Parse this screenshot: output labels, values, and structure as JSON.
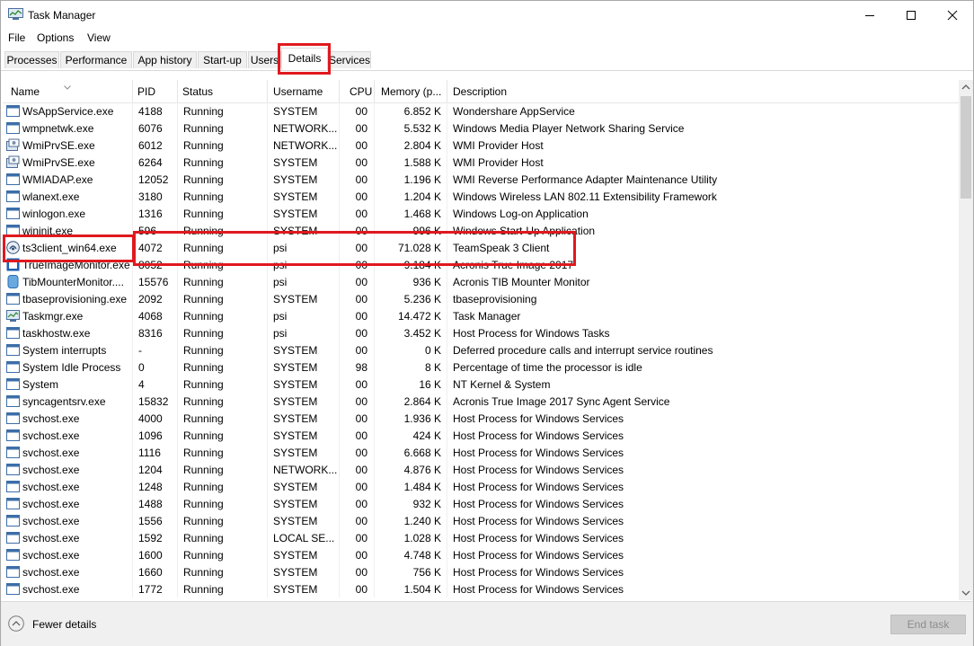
{
  "window": {
    "title": "Task Manager",
    "min_icon": "minimize-icon",
    "max_icon": "maximize-icon",
    "close_icon": "close-icon"
  },
  "menu": [
    "File",
    "Options",
    "View"
  ],
  "tabs": [
    {
      "label": "Processes"
    },
    {
      "label": "Performance"
    },
    {
      "label": "App history"
    },
    {
      "label": "Start-up"
    },
    {
      "label": "Users"
    },
    {
      "label": "Details",
      "active": true
    },
    {
      "label": "Services"
    }
  ],
  "columns": {
    "name": "Name",
    "pid": "PID",
    "status": "Status",
    "username": "Username",
    "cpu": "CPU",
    "memory": "Memory (p...",
    "description": "Description"
  },
  "rows": [
    {
      "icon": "app-icon",
      "name": "WsAppService.exe",
      "pid": "4188",
      "status": "Running",
      "user": "SYSTEM",
      "cpu": "00",
      "mem": "6.852 K",
      "desc": "Wondershare AppService"
    },
    {
      "icon": "app-icon",
      "name": "wmpnetwk.exe",
      "pid": "6076",
      "status": "Running",
      "user": "NETWORK...",
      "cpu": "00",
      "mem": "5.532 K",
      "desc": "Windows Media Player Network Sharing Service"
    },
    {
      "icon": "wmi-icon",
      "name": "WmiPrvSE.exe",
      "pid": "6012",
      "status": "Running",
      "user": "NETWORK...",
      "cpu": "00",
      "mem": "2.804 K",
      "desc": "WMI Provider Host"
    },
    {
      "icon": "wmi-icon",
      "name": "WmiPrvSE.exe",
      "pid": "6264",
      "status": "Running",
      "user": "SYSTEM",
      "cpu": "00",
      "mem": "1.588 K",
      "desc": "WMI Provider Host"
    },
    {
      "icon": "app-icon",
      "name": "WMIADAP.exe",
      "pid": "12052",
      "status": "Running",
      "user": "SYSTEM",
      "cpu": "00",
      "mem": "1.196 K",
      "desc": "WMI Reverse Performance Adapter Maintenance Utility"
    },
    {
      "icon": "app-icon",
      "name": "wlanext.exe",
      "pid": "3180",
      "status": "Running",
      "user": "SYSTEM",
      "cpu": "00",
      "mem": "1.204 K",
      "desc": "Windows Wireless LAN 802.11 Extensibility Framework"
    },
    {
      "icon": "app-icon",
      "name": "winlogon.exe",
      "pid": "1316",
      "status": "Running",
      "user": "SYSTEM",
      "cpu": "00",
      "mem": "1.468 K",
      "desc": "Windows Log-on Application"
    },
    {
      "icon": "app-icon",
      "name": "wininit.exe",
      "pid": "596",
      "status": "Running",
      "user": "SYSTEM",
      "cpu": "00",
      "mem": "996 K",
      "desc": "Windows Start-Up Application"
    },
    {
      "icon": "teamspeak-icon",
      "name": "ts3client_win64.exe",
      "pid": "4072",
      "status": "Running",
      "user": "psi",
      "cpu": "00",
      "mem": "71.028 K",
      "desc": "TeamSpeak 3 Client"
    },
    {
      "icon": "acronis-icon",
      "name": "TrueImageMonitor.exe",
      "pid": "8052",
      "status": "Running",
      "user": "psi",
      "cpu": "00",
      "mem": "9.184 K",
      "desc": "Acronis True Image 2017"
    },
    {
      "icon": "acronis-tib-icon",
      "name": "TibMounterMonitor....",
      "pid": "15576",
      "status": "Running",
      "user": "psi",
      "cpu": "00",
      "mem": "936 K",
      "desc": "Acronis TIB Mounter Monitor"
    },
    {
      "icon": "app-icon",
      "name": "tbaseprovisioning.exe",
      "pid": "2092",
      "status": "Running",
      "user": "SYSTEM",
      "cpu": "00",
      "mem": "5.236 K",
      "desc": "tbaseprovisioning"
    },
    {
      "icon": "taskmgr-icon",
      "name": "Taskmgr.exe",
      "pid": "4068",
      "status": "Running",
      "user": "psi",
      "cpu": "00",
      "mem": "14.472 K",
      "desc": "Task Manager"
    },
    {
      "icon": "app-icon",
      "name": "taskhostw.exe",
      "pid": "8316",
      "status": "Running",
      "user": "psi",
      "cpu": "00",
      "mem": "3.452 K",
      "desc": "Host Process for Windows Tasks"
    },
    {
      "icon": "app-icon",
      "name": "System interrupts",
      "pid": "-",
      "status": "Running",
      "user": "SYSTEM",
      "cpu": "00",
      "mem": "0 K",
      "desc": "Deferred procedure calls and interrupt service routines"
    },
    {
      "icon": "app-icon",
      "name": "System Idle Process",
      "pid": "0",
      "status": "Running",
      "user": "SYSTEM",
      "cpu": "98",
      "mem": "8 K",
      "desc": "Percentage of time the processor is idle"
    },
    {
      "icon": "app-icon",
      "name": "System",
      "pid": "4",
      "status": "Running",
      "user": "SYSTEM",
      "cpu": "00",
      "mem": "16 K",
      "desc": "NT Kernel & System"
    },
    {
      "icon": "app-icon",
      "name": "syncagentsrv.exe",
      "pid": "15832",
      "status": "Running",
      "user": "SYSTEM",
      "cpu": "00",
      "mem": "2.864 K",
      "desc": "Acronis True Image 2017 Sync Agent Service"
    },
    {
      "icon": "app-icon",
      "name": "svchost.exe",
      "pid": "4000",
      "status": "Running",
      "user": "SYSTEM",
      "cpu": "00",
      "mem": "1.936 K",
      "desc": "Host Process for Windows Services"
    },
    {
      "icon": "app-icon",
      "name": "svchost.exe",
      "pid": "1096",
      "status": "Running",
      "user": "SYSTEM",
      "cpu": "00",
      "mem": "424 K",
      "desc": "Host Process for Windows Services"
    },
    {
      "icon": "app-icon",
      "name": "svchost.exe",
      "pid": "1116",
      "status": "Running",
      "user": "SYSTEM",
      "cpu": "00",
      "mem": "6.668 K",
      "desc": "Host Process for Windows Services"
    },
    {
      "icon": "app-icon",
      "name": "svchost.exe",
      "pid": "1204",
      "status": "Running",
      "user": "NETWORK...",
      "cpu": "00",
      "mem": "4.876 K",
      "desc": "Host Process for Windows Services"
    },
    {
      "icon": "app-icon",
      "name": "svchost.exe",
      "pid": "1248",
      "status": "Running",
      "user": "SYSTEM",
      "cpu": "00",
      "mem": "1.484 K",
      "desc": "Host Process for Windows Services"
    },
    {
      "icon": "app-icon",
      "name": "svchost.exe",
      "pid": "1488",
      "status": "Running",
      "user": "SYSTEM",
      "cpu": "00",
      "mem": "932 K",
      "desc": "Host Process for Windows Services"
    },
    {
      "icon": "app-icon",
      "name": "svchost.exe",
      "pid": "1556",
      "status": "Running",
      "user": "SYSTEM",
      "cpu": "00",
      "mem": "1.240 K",
      "desc": "Host Process for Windows Services"
    },
    {
      "icon": "app-icon",
      "name": "svchost.exe",
      "pid": "1592",
      "status": "Running",
      "user": "LOCAL SE...",
      "cpu": "00",
      "mem": "1.028 K",
      "desc": "Host Process for Windows Services"
    },
    {
      "icon": "app-icon",
      "name": "svchost.exe",
      "pid": "1600",
      "status": "Running",
      "user": "SYSTEM",
      "cpu": "00",
      "mem": "4.748 K",
      "desc": "Host Process for Windows Services"
    },
    {
      "icon": "app-icon",
      "name": "svchost.exe",
      "pid": "1660",
      "status": "Running",
      "user": "SYSTEM",
      "cpu": "00",
      "mem": "756 K",
      "desc": "Host Process for Windows Services"
    },
    {
      "icon": "app-icon",
      "name": "svchost.exe",
      "pid": "1772",
      "status": "Running",
      "user": "SYSTEM",
      "cpu": "00",
      "mem": "1.504 K",
      "desc": "Host Process for Windows Services"
    }
  ],
  "footer": {
    "fewer_details": "Fewer details",
    "end_task": "End task"
  },
  "colors": {
    "highlight": "#e0191f",
    "disabled_button": "#cccccc"
  }
}
